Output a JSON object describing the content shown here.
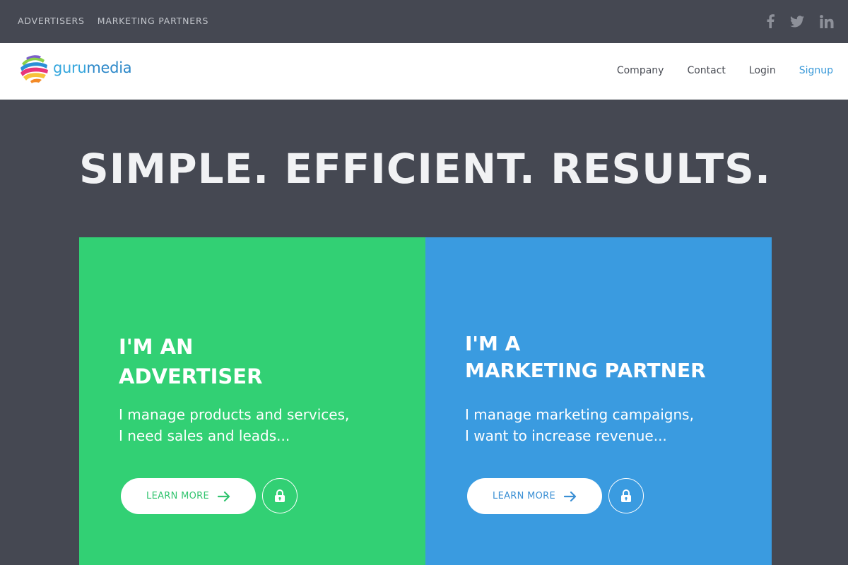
{
  "topbar": {
    "links": [
      "ADVERTISERS",
      "MARKETING PARTNERS"
    ],
    "social": [
      {
        "icon": "facebook-icon",
        "glyph": "f"
      },
      {
        "icon": "twitter-icon",
        "glyph": "🐦"
      },
      {
        "icon": "linkedin-icon",
        "glyph": "in"
      }
    ]
  },
  "header": {
    "logo_part1": "guru",
    "logo_part2": "media",
    "nav": [
      "Company",
      "Contact",
      "Login",
      "Signup"
    ]
  },
  "hero": {
    "title": "SIMPLE. EFFICIENT. RESULTS.",
    "advertiser": {
      "heading_line1": "I'M AN",
      "heading_line2": "ADVERTISER",
      "text_line1": "I manage products and services,",
      "text_line2": "I need sales and leads...",
      "button": "LEARN MORE"
    },
    "partner": {
      "heading_line1": "I'M A",
      "heading_line2": "MARKETING PARTNER",
      "text_line1": "I manage marketing campaigns,",
      "text_line2": "I want to increase revenue...",
      "button": "LEARN MORE"
    }
  },
  "colors": {
    "background": "#454852",
    "green": "#32d074",
    "blue": "#3a9be0",
    "link_accent": "#3c9ad9"
  }
}
